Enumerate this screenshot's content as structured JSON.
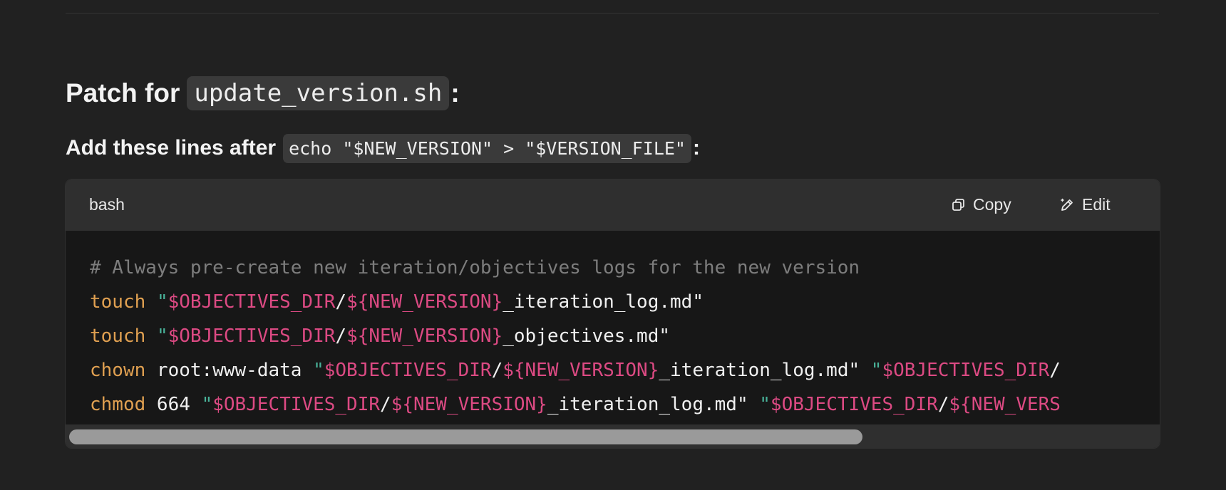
{
  "heading": {
    "prefix": "Patch for",
    "code": "update_version.sh",
    "suffix": ":"
  },
  "subline": {
    "prefix": "Add these lines after",
    "code": "echo \"$NEW_VERSION\" > \"$VERSION_FILE\"",
    "suffix": ":"
  },
  "codeblock": {
    "language": "bash",
    "copy_label": "Copy",
    "edit_label": "Edit",
    "lines": [
      [
        {
          "t": "comment",
          "v": "# Always pre-create new iteration/objectives logs for the new version"
        }
      ],
      [
        {
          "t": "cmd",
          "v": "touch"
        },
        {
          "t": "plain",
          "v": " "
        },
        {
          "t": "str",
          "v": "\""
        },
        {
          "t": "var",
          "v": "$OBJECTIVES_DIR"
        },
        {
          "t": "plain",
          "v": "/"
        },
        {
          "t": "var",
          "v": "${NEW_VERSION}"
        },
        {
          "t": "plain",
          "v": "_iteration_log.md\""
        }
      ],
      [
        {
          "t": "cmd",
          "v": "touch"
        },
        {
          "t": "plain",
          "v": " "
        },
        {
          "t": "str",
          "v": "\""
        },
        {
          "t": "var",
          "v": "$OBJECTIVES_DIR"
        },
        {
          "t": "plain",
          "v": "/"
        },
        {
          "t": "var",
          "v": "${NEW_VERSION}"
        },
        {
          "t": "plain",
          "v": "_objectives.md\""
        }
      ],
      [
        {
          "t": "cmd",
          "v": "chown"
        },
        {
          "t": "plain",
          "v": " root:www-data "
        },
        {
          "t": "str",
          "v": "\""
        },
        {
          "t": "var",
          "v": "$OBJECTIVES_DIR"
        },
        {
          "t": "plain",
          "v": "/"
        },
        {
          "t": "var",
          "v": "${NEW_VERSION}"
        },
        {
          "t": "plain",
          "v": "_iteration_log.md\" "
        },
        {
          "t": "str",
          "v": "\""
        },
        {
          "t": "var",
          "v": "$OBJECTIVES_DIR"
        },
        {
          "t": "plain",
          "v": "/"
        }
      ],
      [
        {
          "t": "cmd",
          "v": "chmod"
        },
        {
          "t": "plain",
          "v": " 664 "
        },
        {
          "t": "str",
          "v": "\""
        },
        {
          "t": "var",
          "v": "$OBJECTIVES_DIR"
        },
        {
          "t": "plain",
          "v": "/"
        },
        {
          "t": "var",
          "v": "${NEW_VERSION}"
        },
        {
          "t": "plain",
          "v": "_iteration_log.md\" "
        },
        {
          "t": "str",
          "v": "\""
        },
        {
          "t": "var",
          "v": "$OBJECTIVES_DIR"
        },
        {
          "t": "plain",
          "v": "/"
        },
        {
          "t": "var",
          "v": "${NEW_VERS"
        }
      ]
    ]
  },
  "icons": {
    "copy": "copy-icon",
    "edit": "edit-pencil-icon"
  },
  "colors": {
    "comment": "#7d7d7d",
    "command": "#e0a051",
    "string": "#49b39a",
    "variable": "#dc4a83",
    "text": "#f0f0f0"
  },
  "scrollbar": {
    "position_fraction": 0.0,
    "visible_fraction": 0.73
  }
}
